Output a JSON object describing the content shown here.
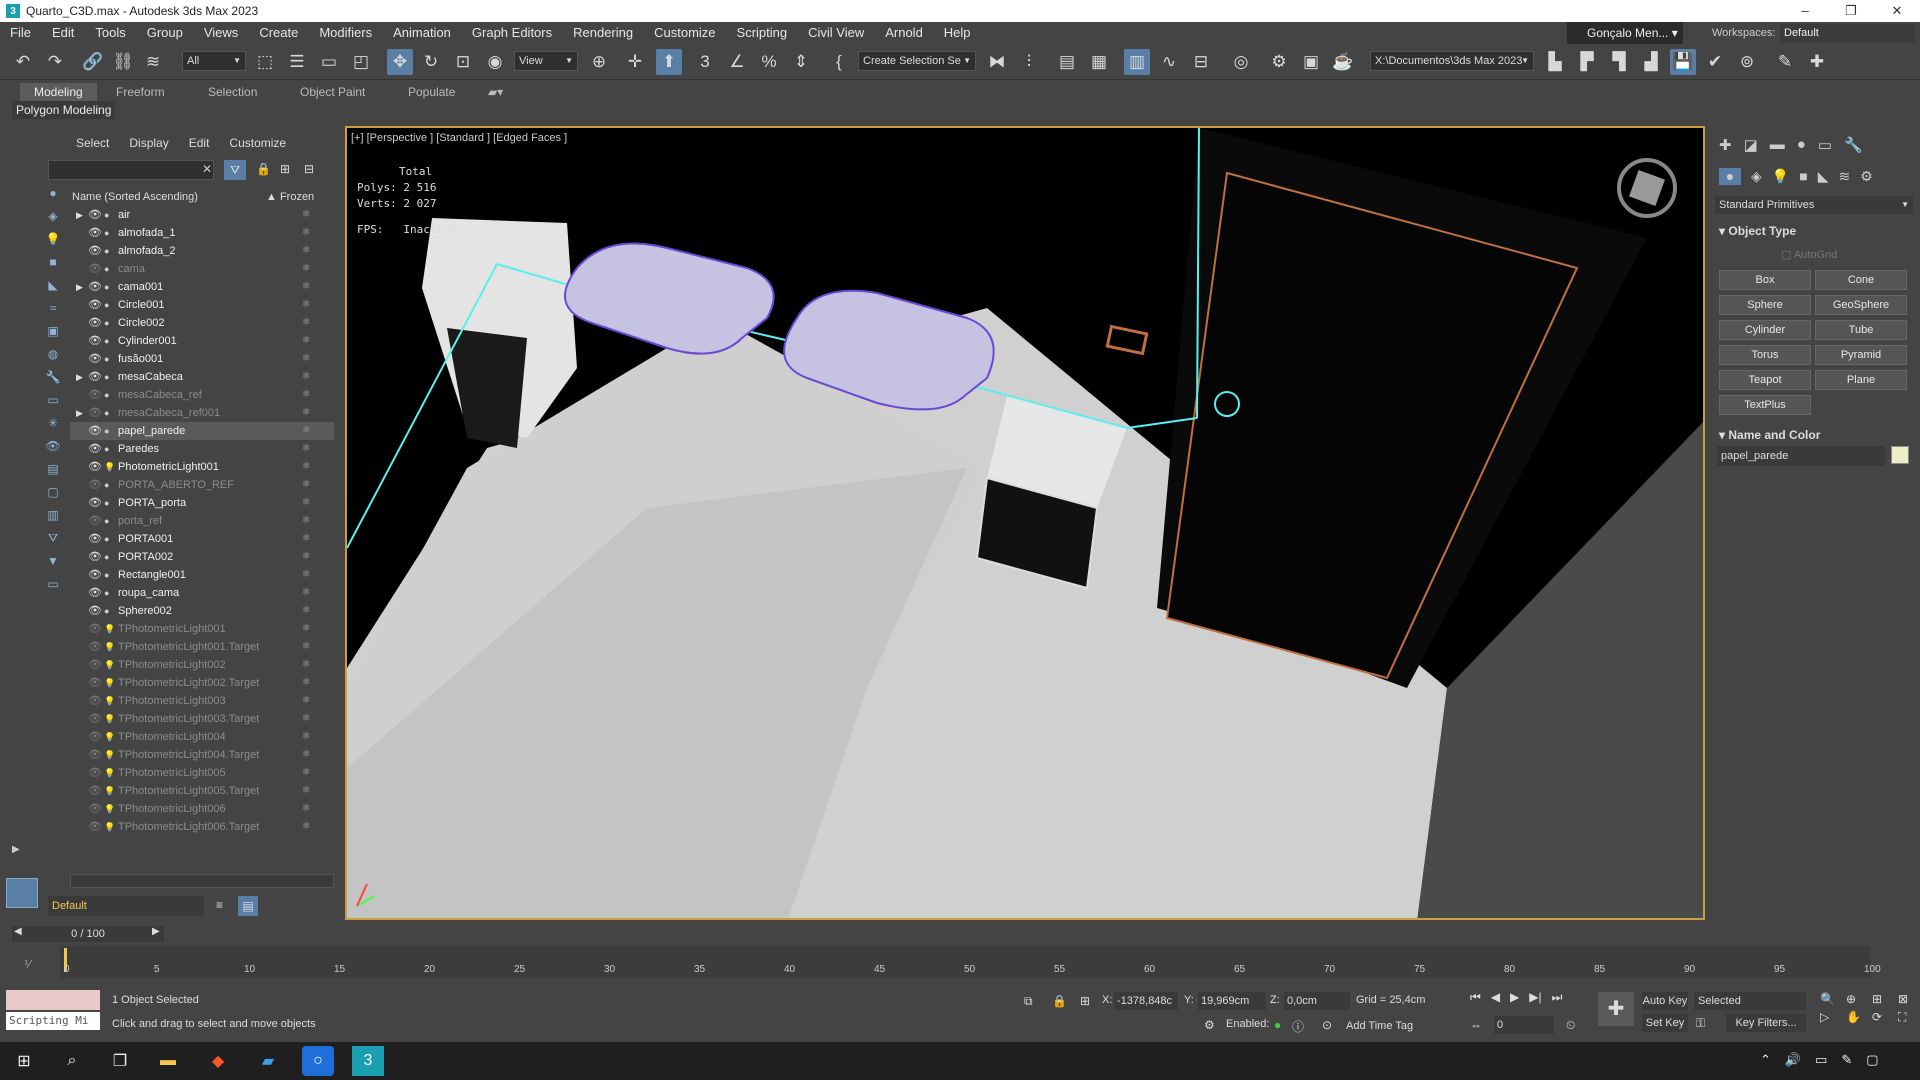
{
  "window": {
    "title": "Quarto_C3D.max - Autodesk 3ds Max 2023",
    "app_icon": "3ds-max-icon",
    "controls": [
      "–",
      "❐",
      "✕"
    ]
  },
  "menu": [
    "File",
    "Edit",
    "Tools",
    "Group",
    "Views",
    "Create",
    "Modifiers",
    "Animation",
    "Graph Editors",
    "Rendering",
    "Customize",
    "Scripting",
    "Civil View",
    "Arnold",
    "Help"
  ],
  "user": "Gonçalo Men...",
  "workspaces_label": "Workspaces:",
  "workspace": "Default",
  "toolbar": {
    "filter": "All",
    "view": "View",
    "selection_set": "Create Selection Se",
    "path": "X:\\Documentos\\3ds Max 2023"
  },
  "ribbon": {
    "tabs": [
      "Modeling",
      "Freeform",
      "Selection",
      "Object Paint",
      "Populate"
    ],
    "selected": "Modeling",
    "sub": "Polygon Modeling"
  },
  "explorer": {
    "menu": [
      "Select",
      "Display",
      "Edit",
      "Customize"
    ],
    "col_name": "Name (Sorted Ascending)",
    "col_frozen": "▲ Frozen",
    "rows": [
      {
        "name": "air",
        "exp": true,
        "dim": false
      },
      {
        "name": "almofada_1",
        "exp": false,
        "dim": false
      },
      {
        "name": "almofada_2",
        "exp": false,
        "dim": false
      },
      {
        "name": "cama",
        "exp": false,
        "dim": true
      },
      {
        "name": "cama001",
        "exp": true,
        "dim": false
      },
      {
        "name": "Circle001",
        "exp": false,
        "dim": false
      },
      {
        "name": "Circle002",
        "exp": false,
        "dim": false
      },
      {
        "name": "Cylinder001",
        "exp": false,
        "dim": false
      },
      {
        "name": "fusão001",
        "exp": false,
        "dim": false
      },
      {
        "name": "mesaCabeca",
        "exp": true,
        "dim": false
      },
      {
        "name": "mesaCabeca_ref",
        "exp": false,
        "dim": true
      },
      {
        "name": "mesaCabeca_ref001",
        "exp": true,
        "dim": true
      },
      {
        "name": "papel_parede",
        "exp": false,
        "dim": false,
        "sel": true
      },
      {
        "name": "Paredes",
        "exp": false,
        "dim": false
      },
      {
        "name": "PhotometricLight001",
        "exp": false,
        "dim": false,
        "light": true
      },
      {
        "name": "PORTA_ABERTO_REF",
        "exp": false,
        "dim": true
      },
      {
        "name": "PORTA_porta",
        "exp": false,
        "dim": false
      },
      {
        "name": "porta_ref",
        "exp": false,
        "dim": true
      },
      {
        "name": "PORTA001",
        "exp": false,
        "dim": false
      },
      {
        "name": "PORTA002",
        "exp": false,
        "dim": false
      },
      {
        "name": "Rectangle001",
        "exp": false,
        "dim": false
      },
      {
        "name": "roupa_cama",
        "exp": false,
        "dim": false
      },
      {
        "name": "Sphere002",
        "exp": false,
        "dim": false
      },
      {
        "name": "TPhotometricLight001",
        "exp": false,
        "dim": true,
        "light": true
      },
      {
        "name": "TPhotometricLight001.Target",
        "exp": false,
        "dim": true,
        "light": true
      },
      {
        "name": "TPhotometricLight002",
        "exp": false,
        "dim": true,
        "light": true
      },
      {
        "name": "TPhotometricLight002.Target",
        "exp": false,
        "dim": true,
        "light": true
      },
      {
        "name": "TPhotometricLight003",
        "exp": false,
        "dim": true,
        "light": true
      },
      {
        "name": "TPhotometricLight003.Target",
        "exp": false,
        "dim": true,
        "light": true
      },
      {
        "name": "TPhotometricLight004",
        "exp": false,
        "dim": true,
        "light": true
      },
      {
        "name": "TPhotometricLight004.Target",
        "exp": false,
        "dim": true,
        "light": true
      },
      {
        "name": "TPhotometricLight005",
        "exp": false,
        "dim": true,
        "light": true
      },
      {
        "name": "TPhotometricLight005.Target",
        "exp": false,
        "dim": true,
        "light": true
      },
      {
        "name": "TPhotometricLight006",
        "exp": false,
        "dim": true,
        "light": true
      },
      {
        "name": "TPhotometricLight006.Target",
        "exp": false,
        "dim": true,
        "light": true
      }
    ],
    "layer": "Default"
  },
  "viewport": {
    "label": "[+] [Perspective ] [Standard ] [Edged Faces ]",
    "stats_total": "Total",
    "polys_label": "Polys:",
    "polys": "2 516",
    "verts_label": "Verts:",
    "verts": "2 027",
    "fps_label": "FPS:",
    "fps": "Inactive"
  },
  "command_panel": {
    "category": "Standard Primitives",
    "object_type": "Object Type",
    "autogrid": "AutoGrid",
    "buttons": [
      "Box",
      "Cone",
      "Sphere",
      "GeoSphere",
      "Cylinder",
      "Tube",
      "Torus",
      "Pyramid",
      "Teapot",
      "Plane",
      "TextPlus"
    ],
    "name_color": "Name and Color",
    "object_name": "papel_parede",
    "object_color": "#eeeec4"
  },
  "timeline": {
    "frame": "0 / 100",
    "ticks": [
      "0",
      "5",
      "10",
      "15",
      "20",
      "25",
      "30",
      "35",
      "40",
      "45",
      "50",
      "55",
      "60",
      "65",
      "70",
      "75",
      "80",
      "85",
      "90",
      "95",
      "100"
    ]
  },
  "status": {
    "selected": "1 Object Selected",
    "prompt": "Click and drag to select and move objects",
    "script": "Scripting Mi",
    "x_label": "X:",
    "x": "-1378,848c",
    "y_label": "Y:",
    "y": "19,969cm",
    "z_label": "Z:",
    "z": "0,0cm",
    "grid": "Grid = 25,4cm",
    "enabled": "Enabled:",
    "add_time_tag": "Add Time Tag",
    "auto_key": "Auto Key",
    "set_key": "Set Key",
    "key_mode": "Selected",
    "key_filters": "Key Filters...",
    "frame_field": "0"
  },
  "colors": {
    "accent": "#5a7fa6",
    "viewport_border": "#c8a040",
    "wire_select": "#5aefef",
    "pillow_wire": "#7a5ad8",
    "door_trim": "#c07040"
  }
}
